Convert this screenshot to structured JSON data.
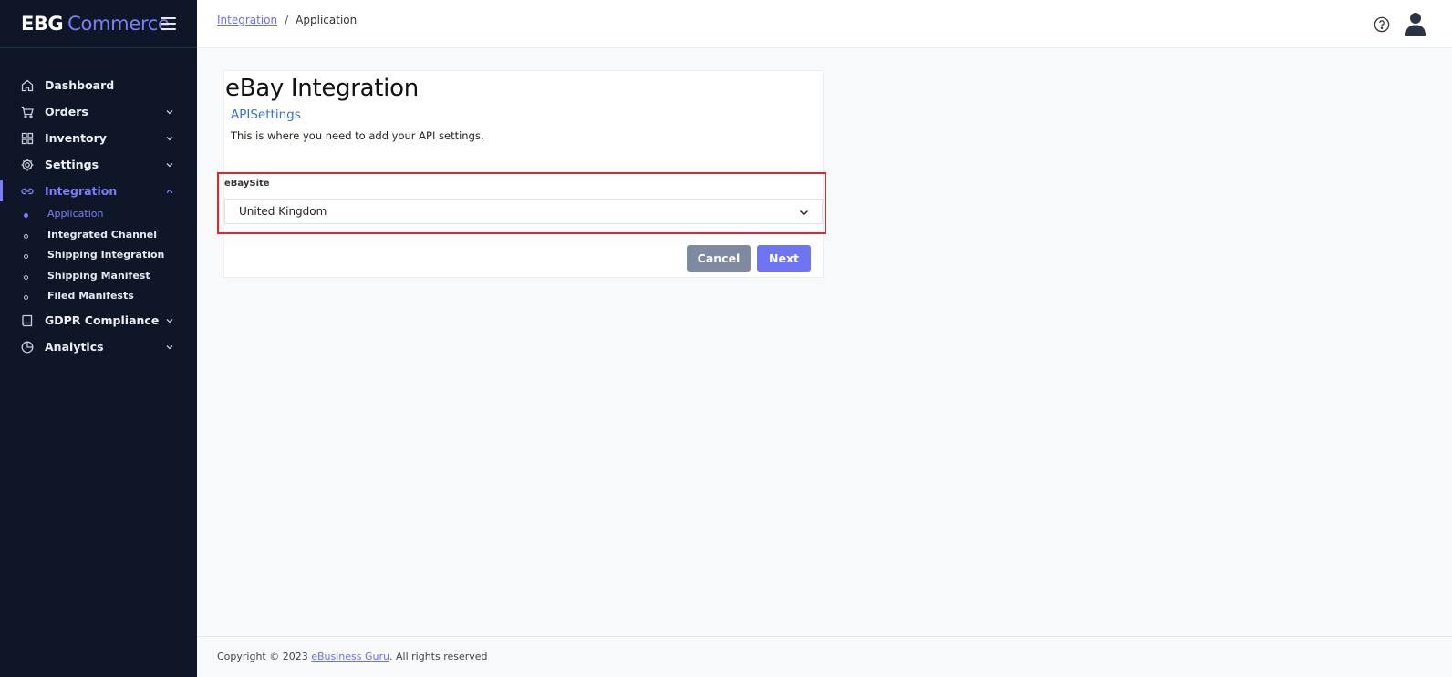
{
  "brand": {
    "part1": "EBG",
    "part2": "Commerce"
  },
  "sidebar": {
    "items": [
      {
        "label": "Dashboard",
        "icon": "home-icon"
      },
      {
        "label": "Orders",
        "icon": "cart-icon"
      },
      {
        "label": "Inventory",
        "icon": "grid-icon"
      },
      {
        "label": "Settings",
        "icon": "gear-icon"
      },
      {
        "label": "Integration",
        "icon": "link-icon"
      },
      {
        "label": "GDPR Compliance",
        "icon": "book-icon"
      },
      {
        "label": "Analytics",
        "icon": "pie-chart-icon"
      }
    ],
    "subitems": [
      {
        "label": "Application"
      },
      {
        "label": "Integrated Channel"
      },
      {
        "label": "Shipping Integration"
      },
      {
        "label": "Shipping Manifest"
      },
      {
        "label": "Filed Manifests"
      }
    ]
  },
  "breadcrumb": {
    "parent": "Integration",
    "separator": "/",
    "current": "Application"
  },
  "card": {
    "title": "eBay Integration",
    "subtitle": "APISettings",
    "description": "This is where you need to add your API settings.",
    "field_label": "eBaySite",
    "select_value": "United Kingdom",
    "cancel_label": "Cancel",
    "next_label": "Next"
  },
  "footer": {
    "prefix": "Copyright © 2023 ",
    "link": "eBusiness Guru",
    "suffix": ". All rights reserved"
  },
  "colors": {
    "sidebar_bg": "#0f1628",
    "accent": "#6f74f3",
    "highlight": "#e2262a",
    "cancel": "#7f8aa0",
    "subtitle": "#3d6fd9"
  }
}
